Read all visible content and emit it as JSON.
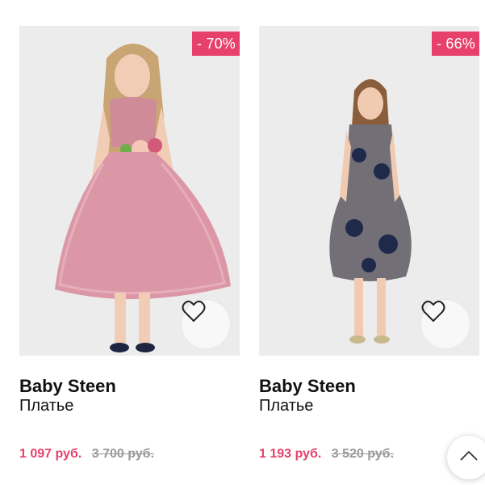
{
  "products": [
    {
      "brand": "Baby Steen",
      "type": "Платье",
      "discount": "- 70%",
      "price": "1 097 руб.",
      "old_price": "3 700 руб.",
      "image": "girl-in-pink-tulle-dress"
    },
    {
      "brand": "Baby Steen",
      "type": "Платье",
      "discount": "- 66%",
      "price": "1 193 руб.",
      "old_price": "3 520 руб.",
      "image": "girl-in-navy-lace-dress"
    }
  ],
  "icons": {
    "favorite": "heart-icon",
    "scroll_top": "chevron-up-icon"
  },
  "colors": {
    "accent": "#e6406b",
    "old_price": "#9a9a9a"
  }
}
